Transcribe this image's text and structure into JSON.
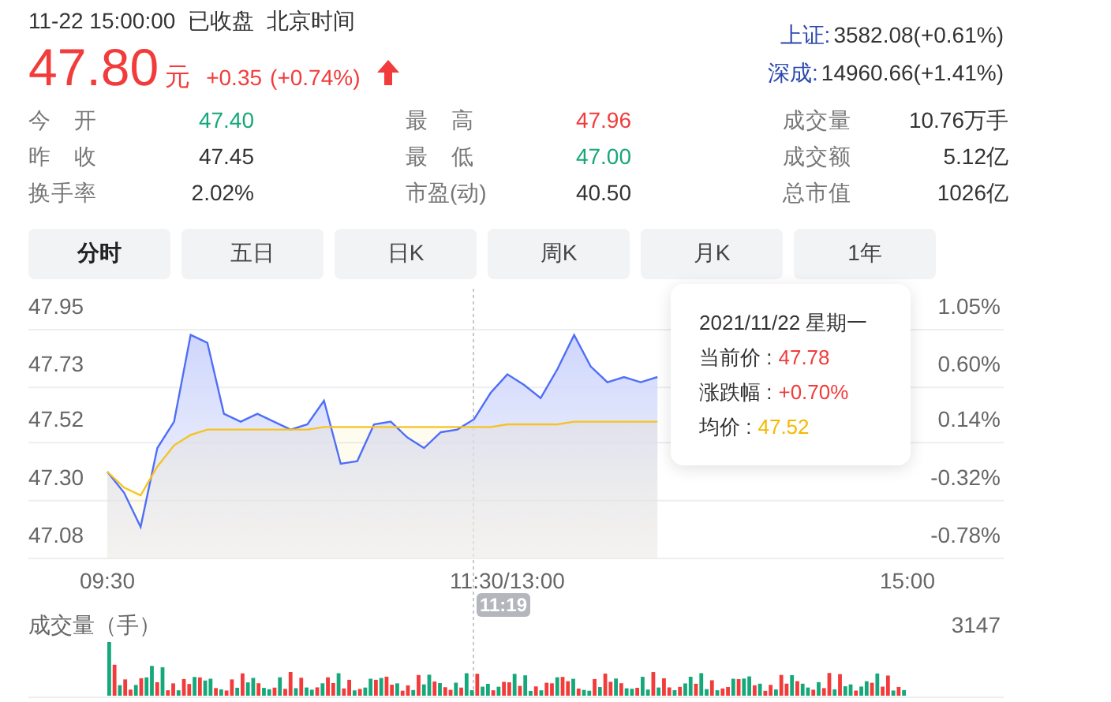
{
  "quote": {
    "datetime": "11-22 15:00:00",
    "status": "已收盘",
    "timezone": "北京时间",
    "price": "47.80",
    "unit": "元",
    "change": "+0.35",
    "change_pct": "(+0.74%)",
    "kind": "up"
  },
  "indices": [
    {
      "name": "上证:",
      "value": "3582.08(+0.61%)"
    },
    {
      "name": "深成:",
      "value": "14960.66(+1.41%)"
    }
  ],
  "stats": [
    [
      {
        "label": "今 开",
        "value": "47.40",
        "color": "#16a87a"
      },
      {
        "label": "昨 收",
        "value": "47.45"
      },
      {
        "label": "换手率",
        "value": "2.02%"
      }
    ],
    [
      {
        "label": "最 高",
        "value": "47.96",
        "color": "#f23b3b"
      },
      {
        "label": "最 低",
        "value": "47.00",
        "color": "#16a87a"
      },
      {
        "label": "市盈(动)",
        "value": "40.50"
      }
    ],
    [
      {
        "label": "成交量",
        "value": "10.76万手"
      },
      {
        "label": "成交额",
        "value": "5.12亿"
      },
      {
        "label": "总市值",
        "value": "1026亿"
      }
    ]
  ],
  "tabs": [
    {
      "label": "分时",
      "selected": true
    },
    {
      "label": "五日",
      "selected": false
    },
    {
      "label": "日K",
      "selected": false
    },
    {
      "label": "周K",
      "selected": false
    },
    {
      "label": "月K",
      "selected": false
    },
    {
      "label": "1年",
      "selected": false
    }
  ],
  "chart": {
    "chart_data": {
      "type": "area",
      "grid": true,
      "categories": [
        "09:30",
        null,
        null,
        null,
        null,
        null,
        null,
        null,
        null,
        null,
        null,
        null,
        null,
        null,
        null,
        null,
        null,
        null,
        null,
        null,
        null,
        null,
        null,
        null,
        "11:30/13:00",
        null,
        null,
        null,
        null,
        null,
        null,
        null,
        null,
        null,
        null,
        null,
        null,
        null,
        null,
        null,
        null,
        null,
        null,
        null,
        null,
        null,
        null,
        null,
        "15:00"
      ],
      "yticks": [
        {
          "value": 47.08,
          "label": "47.08"
        },
        {
          "value": 47.3,
          "label": "47.30"
        },
        {
          "value": 47.52,
          "label": "47.52"
        },
        {
          "value": 47.73,
          "label": "47.73"
        },
        {
          "value": 47.95,
          "label": "47.95"
        }
      ],
      "ylim": [
        47.08,
        47.95
      ],
      "series": [
        {
          "color": "#4f6ef7",
          "values": [
            47.41,
            47.33,
            47.2,
            47.5,
            47.6,
            47.93,
            47.9,
            47.63,
            47.6,
            47.63,
            47.6,
            47.57,
            47.59,
            47.68,
            47.44,
            47.45,
            47.59,
            47.6,
            47.54,
            47.5,
            47.56,
            47.57,
            47.61,
            47.71,
            47.78,
            47.74,
            47.69,
            47.8,
            47.93,
            47.81,
            47.75,
            47.77,
            47.75,
            47.77,
            null,
            null,
            null,
            null,
            null,
            null,
            null,
            null,
            null,
            null,
            null,
            null,
            null,
            null,
            null
          ]
        },
        {
          "color": "#f5c323",
          "values": [
            47.41,
            47.35,
            47.32,
            47.43,
            47.51,
            47.55,
            47.57,
            47.57,
            47.57,
            47.57,
            47.57,
            47.57,
            47.57,
            47.58,
            47.58,
            47.58,
            47.58,
            47.58,
            47.58,
            47.58,
            47.58,
            47.58,
            47.58,
            47.58,
            47.59,
            47.59,
            47.59,
            47.59,
            47.6,
            47.6,
            47.6,
            47.6,
            47.6,
            47.6,
            null,
            null,
            null,
            null,
            null,
            null,
            null,
            null,
            null,
            null,
            null,
            null,
            null,
            null,
            null
          ]
        }
      ]
    },
    "right_ticks": [
      "1.05%",
      "0.60%",
      "0.14%",
      "-0.32%",
      "-0.78%"
    ],
    "crosshair_time": "11:19",
    "tooltip": {
      "date": "2021/11/22 星期一",
      "rows": [
        {
          "label": "当前价 :",
          "value": "47.78",
          "kind": "up"
        },
        {
          "label": "涨跌幅 :",
          "value": "+0.70%",
          "kind": "up"
        },
        {
          "label": "均价 :",
          "value": "47.52",
          "kind": "avg"
        }
      ]
    },
    "volume": {
      "label": "成交量（手）",
      "max": "3147"
    }
  }
}
